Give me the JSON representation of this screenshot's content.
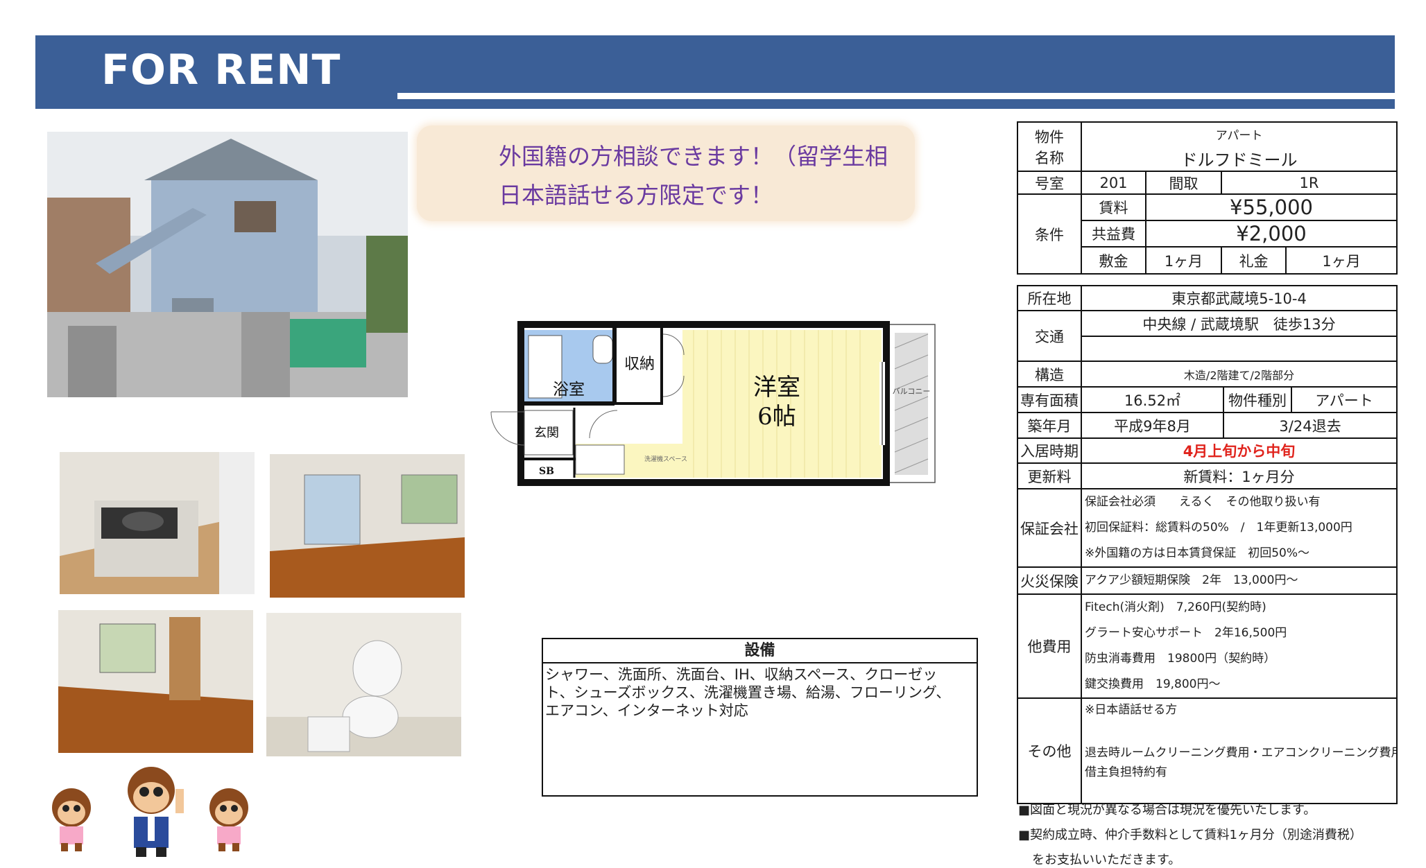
{
  "banner": {
    "title": "FOR RENT"
  },
  "notice": {
    "line1": "外国籍の方相談できます！（留学生相",
    "line2": "日本語話せる方限定です！"
  },
  "floorplan": {
    "bath": "浴室",
    "storage": "収納",
    "room": "洋室",
    "room_size": "6帖",
    "entrance": "玄関",
    "sb": "SB",
    "balcony": "バルコニー",
    "washer": "洗濯機スペース"
  },
  "equipment": {
    "title": "設備",
    "text": "シャワー、洗面所、洗面台、IH、収納スペース、クローゼット、シューズボックス、洗濯機置き場、給湯、フローリング、エアコン、インターネット対応"
  },
  "property": {
    "name_label_1": "物件",
    "name_label_2": "名称",
    "type": "アパート",
    "name": "ドルフドミール",
    "room_label": "号室",
    "room_no": "201",
    "layout_label": "間取",
    "layout": "1R",
    "terms_label": "条件",
    "rent_label": "賃料",
    "rent": "¥55,000",
    "common_label": "共益費",
    "common": "¥2,000",
    "deposit_label": "敷金",
    "deposit": "1ヶ月",
    "key_money_label": "礼金",
    "key_money": "1ヶ月"
  },
  "details": {
    "address_label": "所在地",
    "address": "東京都武蔵境5-10-4",
    "transport_label": "交通",
    "transport": "中央線 / 武蔵境駅　徒歩13分",
    "structure_label": "構造",
    "structure": "木造/2階建て/2階部分",
    "area_label": "専有面積",
    "area": "16.52㎡",
    "ptype_label": "物件種別",
    "ptype": "アパート",
    "built_label": "築年月",
    "built": "平成9年8月",
    "vacate": "3/24退去",
    "movein_label": "入居時期",
    "movein": "4月上旬から中旬",
    "renewal_label": "更新料",
    "renewal": "新賃料：1ヶ月分",
    "guarantee_label": "保証会社",
    "guarantee_1": "保証会社必須　　えるく　その他取り扱い有",
    "guarantee_2": "初回保証料：総賃料の50%　/　1年更新13,000円",
    "guarantee_3": "※外国籍の方は日本賃貸保証　初回50%〜",
    "insurance_label": "火災保険",
    "insurance": "アクア少額短期保険　2年　13,000円〜",
    "other_fees_label": "他費用",
    "fee_1": "Fitech(消火剤)　7,260円(契約時)",
    "fee_2": "グラート安心サポート　2年16,500円",
    "fee_3": "防虫消毒費用　19800円（契約時）",
    "fee_4": "鍵交換費用　19,800円〜",
    "other_label": "その他",
    "other_1": "※日本語話せる方",
    "other_2": "退去時ルームクリーニング費用・エアコンクリーニング費用",
    "other_3": "借主負担特約有"
  },
  "notes": {
    "note_1": "■図面と現況が異なる場合は現況を優先いたします。",
    "note_2": "■契約成立時、仲介手数料として賃料1ヶ月分（別途消費税）",
    "note_3": "をお支払いいただきます。"
  }
}
